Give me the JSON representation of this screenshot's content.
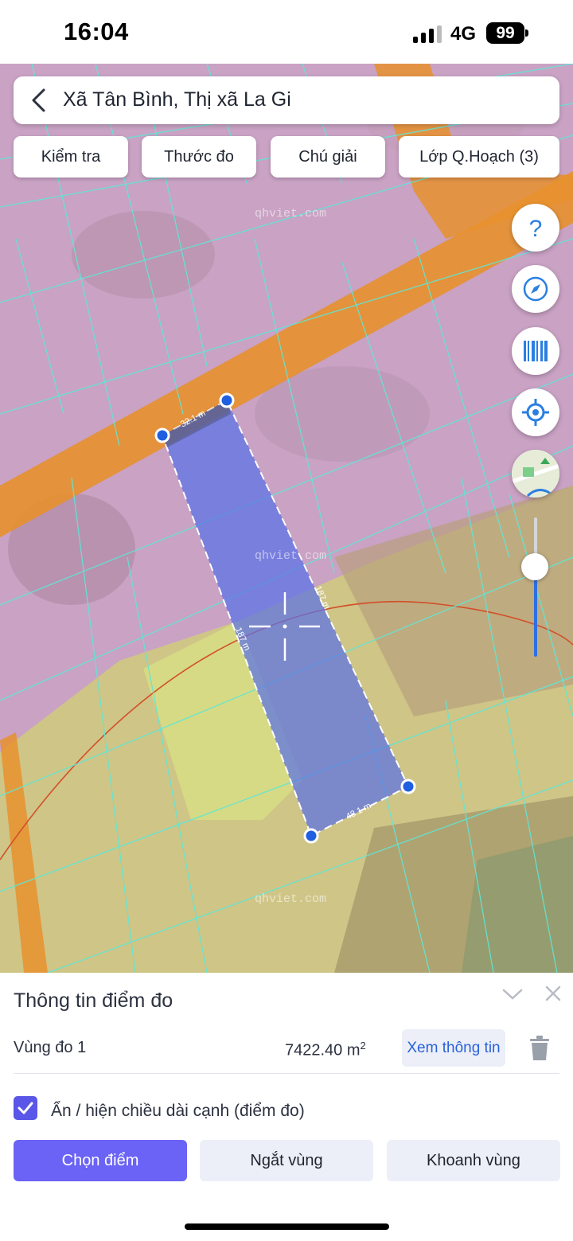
{
  "status_bar": {
    "time": "16:04",
    "network": "4G",
    "battery": "99"
  },
  "search": {
    "location": "Xã Tân Bình, Thị xã La Gi"
  },
  "toolbar": {
    "check": "Kiểm tra",
    "ruler": "Thước đo",
    "legend": "Chú giải",
    "planning_layer": "Lớp Q.Hoạch (3)"
  },
  "map": {
    "watermark": "qhviet.com",
    "edge_labels": {
      "top": "32.1 m",
      "right": "187 m",
      "left": "187 m",
      "bottom": "48.1 m"
    },
    "zoom_level": 0.35,
    "colors": {
      "residential": "#d9a6cf",
      "road": "#e7902e",
      "agriculture": "#d6c67a",
      "parcel_lines": "#5fe7d6",
      "measured_area": "#5a72e6",
      "vertex": "#1f5fe0"
    }
  },
  "map_controls": [
    "help-icon",
    "compass-icon",
    "barcode-icon",
    "locate-icon",
    "map-layer-thumbnail"
  ],
  "panel": {
    "title": "Thông tin điểm đo",
    "area_name": "Vùng đo 1",
    "area_value": "7422.40 m",
    "area_unit_sup": "2",
    "view_info": "Xem thông tin",
    "toggle_label": "Ẩn / hiện chiều dài cạnh (điểm đo)",
    "toggle_checked": true,
    "actions": {
      "select_point": "Chọn điểm",
      "break_area": "Ngắt vùng",
      "enclose_area": "Khoanh vùng"
    },
    "accent": "#6b63f5"
  }
}
